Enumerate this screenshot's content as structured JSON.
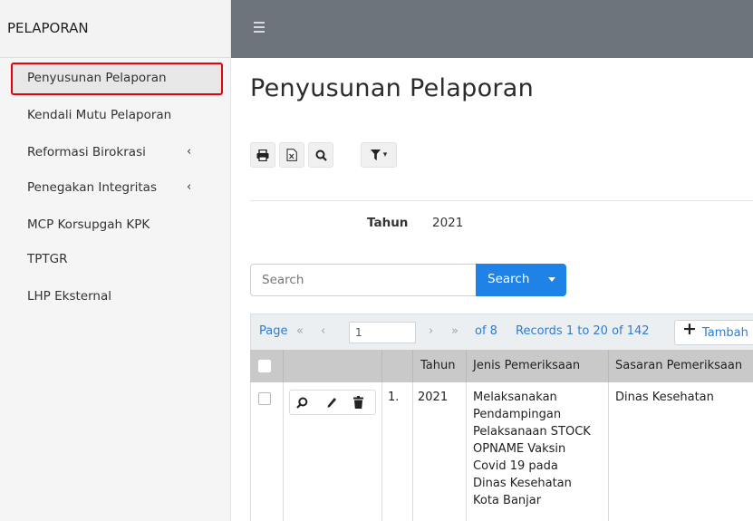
{
  "sidebar": {
    "brand": "PELAPORAN",
    "items": [
      {
        "label": "Penyusunan Pelaporan",
        "active": true,
        "has_caret": false
      },
      {
        "label": "Kendali Mutu Pelaporan",
        "active": false,
        "has_caret": false
      },
      {
        "label": "Reformasi Birokrasi",
        "active": false,
        "has_caret": true
      },
      {
        "label": "Penegakan Integritas",
        "active": false,
        "has_caret": true
      },
      {
        "label": "MCP Korsupgah KPK",
        "active": false,
        "has_caret": false
      },
      {
        "label": "TPTGR",
        "active": false,
        "has_caret": false
      },
      {
        "label": "LHP Eksternal",
        "active": false,
        "has_caret": false
      }
    ],
    "caret_glyph": "‹"
  },
  "topbar": {
    "menu_icon": "hamburger-icon",
    "bg_color": "#6c737a"
  },
  "main": {
    "title": "Penyusunan Pelaporan",
    "toolbar": {
      "icons": [
        "print-icon",
        "excel-icon",
        "search-icon",
        "filter-icon"
      ],
      "filter_caret": "▾"
    },
    "filter": {
      "label": "Tahun",
      "value": "2021"
    },
    "search": {
      "placeholder": "Search",
      "button_label": "Search"
    }
  },
  "pager": {
    "page_label": "Page",
    "first": "«",
    "prev": "‹",
    "page_value": "1",
    "next": "›",
    "last": "»",
    "of_text": "of 8",
    "records_text": "Records 1 to 20 of 142",
    "add_symbol": "+",
    "add_label": "Tambah"
  },
  "table": {
    "columns": [
      "Tahun",
      "Jenis Pemeriksaan",
      "Sasaran Pemeriksaan"
    ],
    "rows": [
      {
        "no": "1.",
        "tahun": "2021",
        "jenis_lines": [
          "Melaksanakan",
          "Pendampingan",
          "Pelaksanaan STOCK",
          "OPNAME Vaksin",
          "Covid 19 pada",
          "Dinas Kesehatan",
          "Kota Banjar"
        ],
        "sasaran": "Dinas Kesehatan"
      }
    ]
  },
  "colors": {
    "accent": "#1e82e6",
    "active_border": "#e8000b",
    "link": "#2d7cd1"
  }
}
